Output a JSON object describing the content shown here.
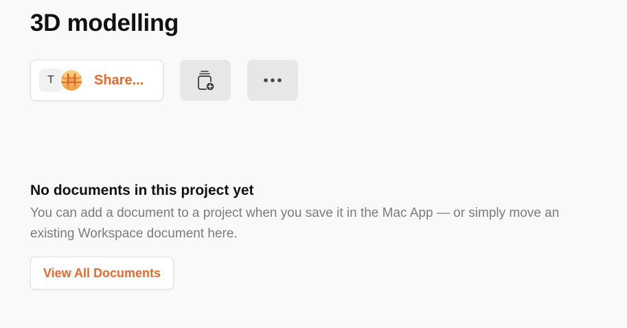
{
  "project": {
    "title": "3D modelling"
  },
  "toolbar": {
    "share": {
      "avatar_initial": "T",
      "avatar_image": "golden-gate-bridge-avatar",
      "label": "Share..."
    },
    "add_document_icon": "document-stack-plus-icon",
    "more_icon": "ellipsis-icon"
  },
  "empty_state": {
    "title": "No documents in this project yet",
    "description": "You can add a document to a project when you save it in the Mac App — or simply move an existing Workspace document here.",
    "button_label": "View All Documents"
  },
  "colors": {
    "accent": "#e8692a",
    "background": "#f9f9f9",
    "icon_button_bg": "#e7e7e7",
    "muted_text": "#7b7b7b"
  }
}
